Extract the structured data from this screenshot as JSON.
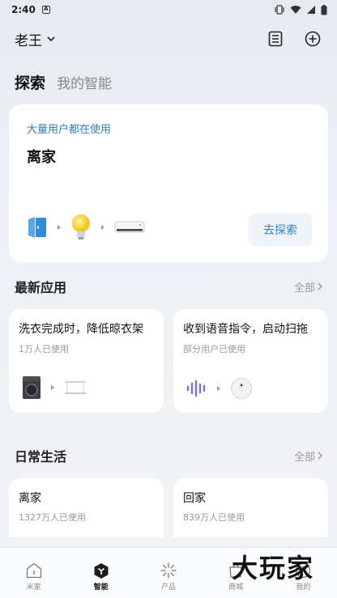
{
  "status_bar": {
    "time": "2:40",
    "badge": "A"
  },
  "topbar": {
    "home_name": "老王"
  },
  "tabs": {
    "active": "探索",
    "inactive": "我的智能"
  },
  "hero": {
    "caption": "大量用户都在使用",
    "title": "离家",
    "button": "去探索",
    "devices": [
      "door-sensor-icon",
      "bulb-icon",
      "air-conditioner-icon"
    ]
  },
  "latest": {
    "title": "最新应用",
    "see_all": "全部",
    "cards": [
      {
        "title": "洗衣完成时，降低晾衣架",
        "sub": "1万人已使用",
        "devices": [
          "washer-icon",
          "drying-rack-icon"
        ]
      },
      {
        "title": "收到语音指令，启动扫拖",
        "sub": "部分用户已使用",
        "devices": [
          "voice-wave-icon",
          "robot-vacuum-icon"
        ]
      }
    ]
  },
  "daily": {
    "title": "日常生活",
    "see_all": "全部",
    "cards": [
      {
        "title": "离家",
        "sub": "1327万人已使用"
      },
      {
        "title": "回家",
        "sub": "839万人已使用"
      }
    ]
  },
  "bottom_nav": {
    "items": [
      {
        "label": "米家",
        "icon": "home-icon"
      },
      {
        "label": "智能",
        "icon": "smart-icon"
      },
      {
        "label": "产品",
        "icon": "products-icon"
      },
      {
        "label": "商城",
        "icon": "mall-icon"
      },
      {
        "label": "我的",
        "icon": "profile-icon"
      }
    ],
    "active": "智能"
  },
  "watermark": "大玩家",
  "colors": {
    "accent": "#2f7fc1",
    "card": "#ffffff",
    "background": "#eef1f5"
  }
}
